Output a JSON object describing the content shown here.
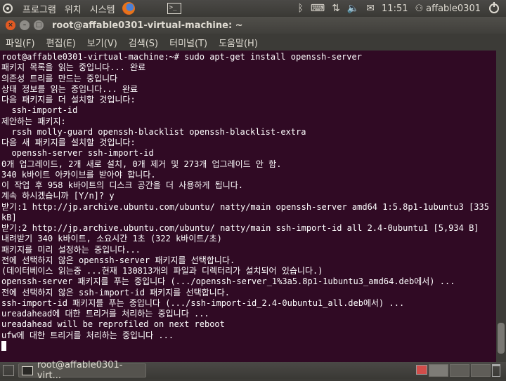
{
  "top_panel": {
    "menus": [
      "프로그램",
      "위치",
      "시스템"
    ],
    "clock": "11:51",
    "user": "affable0301",
    "icons": [
      "bluetooth-icon",
      "keyboard-icon",
      "network-icon",
      "volume-icon",
      "mail-icon",
      "user-icon",
      "power-icon"
    ]
  },
  "window": {
    "title": "root@affable0301-virtual-machine: ~",
    "close_glyph": "×",
    "min_glyph": "–",
    "max_glyph": "□"
  },
  "menubar": {
    "items": [
      "파일(F)",
      "편집(E)",
      "보기(V)",
      "검색(S)",
      "터미널(T)",
      "도움말(H)"
    ]
  },
  "terminal": {
    "lines": [
      "root@affable0301-virtual-machine:~# sudo apt-get install openssh-server",
      "패키지 목록을 읽는 중입니다... 완료",
      "의존성 트리를 만드는 중입니다",
      "상태 정보를 읽는 중입니다... 완료",
      "다음 패키지를 더 설치할 것입니다:",
      "  ssh-import-id",
      "제안하는 패키지:",
      "  rssh molly-guard openssh-blacklist openssh-blacklist-extra",
      "다음 새 패키지를 설치할 것입니다:",
      "  openssh-server ssh-import-id",
      "0개 업그레이드, 2개 새로 설치, 0개 제거 및 273개 업그레이드 안 함.",
      "340 k바이트 아카이브를 받아야 합니다.",
      "이 작업 후 958 k바이트의 디스크 공간을 더 사용하게 됩니다.",
      "계속 하시겠습니까 [Y/n]? y",
      "받기:1 http://jp.archive.ubuntu.com/ubuntu/ natty/main openssh-server amd64 1:5.8p1-1ubuntu3 [335",
      "kB]",
      "받기:2 http://jp.archive.ubuntu.com/ubuntu/ natty/main ssh-import-id all 2.4-0ubuntu1 [5,934 B]",
      "내려받기 340 k바이트, 소요시간 1초 (322 k바이트/초)",
      "패키지를 미리 설정하는 중입니다...",
      "전에 선택하지 않은 openssh-server 패키지를 선택합니다.",
      "(데이터베이스 읽는중 ...현재 130813개의 파일과 디렉터리가 설치되어 있습니다.)",
      "openssh-server 패키지를 푸는 중입니다 (.../openssh-server_1%3a5.8p1-1ubuntu3_amd64.deb에서) ...",
      "전에 선택하지 않은 ssh-import-id 패키지를 선택합니다.",
      "ssh-import-id 패키지를 푸는 중입니다 (.../ssh-import-id_2.4-0ubuntu1_all.deb에서) ...",
      "ureadahead에 대한 트리거를 처리하는 중입니다 ...",
      "ureadahead will be reprofiled on next reboot",
      "ufw에 대한 트리거를 처리하는 중입니다 ..."
    ]
  },
  "bottom_panel": {
    "task_label": "root@affable0301-virt..."
  },
  "colors": {
    "terminal_bg": "#300a24",
    "terminal_fg": "#ffffff",
    "panel_bg": "#3c3b37",
    "close_button": "#e25a23"
  }
}
